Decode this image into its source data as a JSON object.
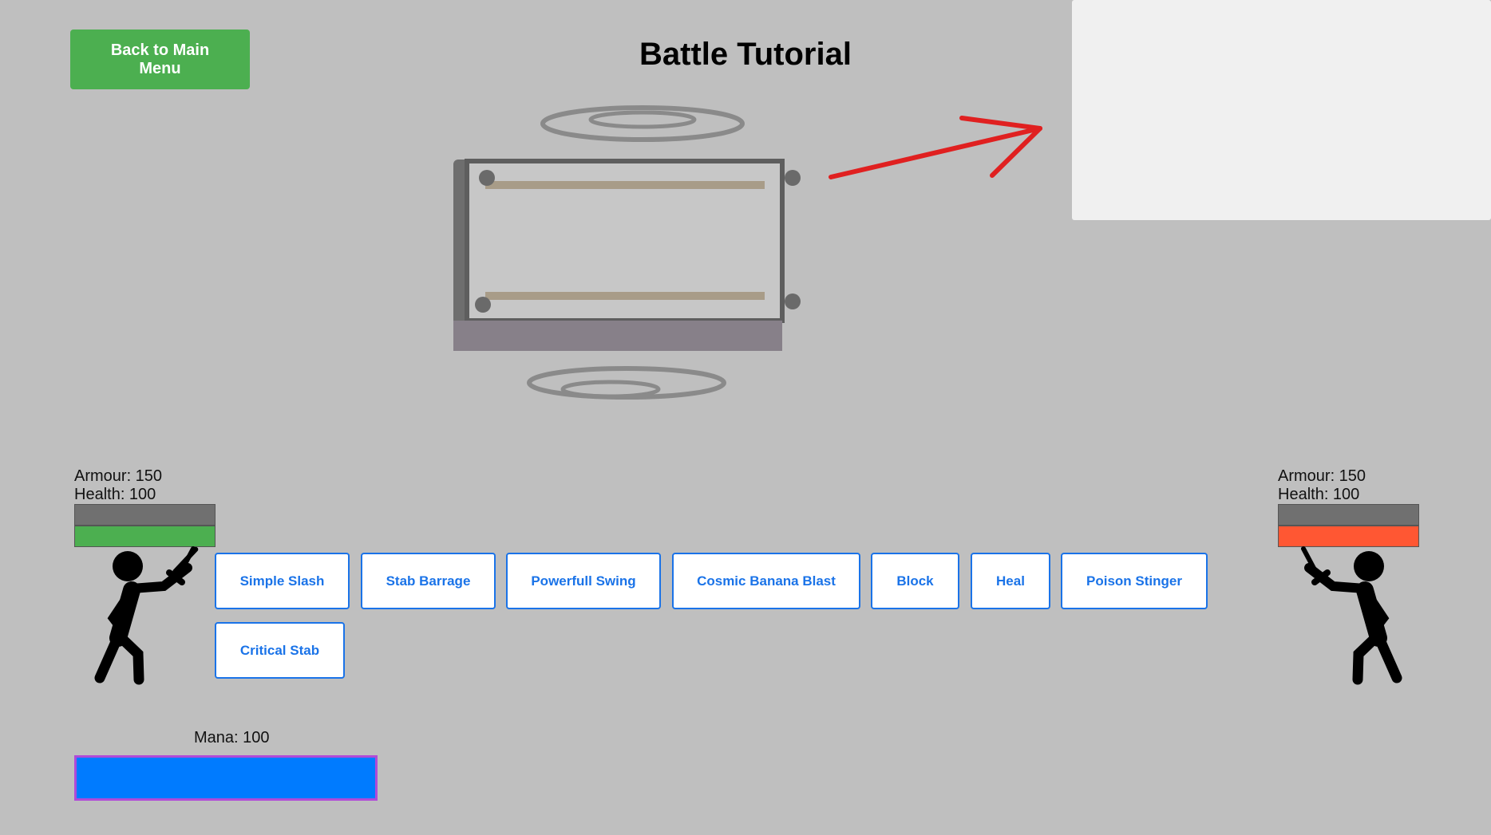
{
  "header": {
    "back_label": "Back to Main Menu",
    "title": "Battle Tutorial"
  },
  "player": {
    "armour_text": "Armour: 150",
    "health_text": "Health: 100",
    "armour_fraction": 1.0,
    "health_fraction": 1.0,
    "health_color": "#4caf50",
    "armour_color": "#707070"
  },
  "enemy": {
    "armour_text": "Armour: 150",
    "health_text": "Health: 100",
    "armour_fraction": 1.0,
    "health_fraction": 1.0,
    "health_color": "#ff5733",
    "armour_color": "#707070"
  },
  "moves": [
    {
      "label": "Simple Slash"
    },
    {
      "label": "Stab Barrage"
    },
    {
      "label": "Powerfull Swing"
    },
    {
      "label": "Cosmic Banana Blast"
    },
    {
      "label": "Block"
    },
    {
      "label": "Heal"
    },
    {
      "label": "Poison Stinger"
    },
    {
      "label": "Critical Stab"
    }
  ],
  "mana": {
    "label": "Mana: 100",
    "fraction": 1.0,
    "fill_color": "#007bff"
  },
  "colors": {
    "background": "#bfbfbf",
    "accent_green": "#4caf50",
    "button_blue": "#1a73e8",
    "arrow_red": "#e02020"
  }
}
